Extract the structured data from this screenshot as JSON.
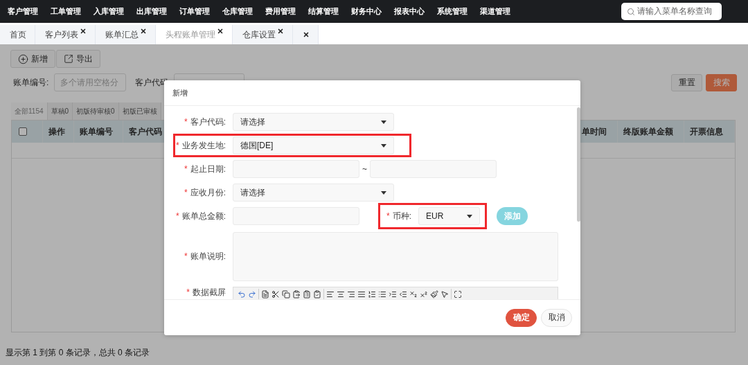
{
  "top_nav": {
    "items": [
      "客户管理",
      "工单管理",
      "入库管理",
      "出库管理",
      "订单管理",
      "仓库管理",
      "费用管理",
      "结算管理",
      "财务中心",
      "报表中心",
      "系统管理",
      "渠道管理"
    ],
    "search": {
      "placeholder": "请输入菜单名称查询"
    }
  },
  "tabs": {
    "items": [
      {
        "label": "首页",
        "selected": false,
        "closable": false
      },
      {
        "label": "客户列表",
        "selected": false,
        "closable": true
      },
      {
        "label": "账单汇总",
        "selected": false,
        "closable": true
      },
      {
        "label": "头程账单管理",
        "selected": true,
        "closable": true
      },
      {
        "label": "仓库设置",
        "selected": false,
        "closable": true
      }
    ],
    "close_all": true
  },
  "toolbar": {
    "buttons": [
      {
        "label": "新增",
        "kind": "add"
      },
      {
        "label": "导出",
        "kind": "export"
      }
    ]
  },
  "filters": [
    {
      "label": "账单编号:",
      "placeholder": "多个请用空格分"
    },
    {
      "label": "客户代码"
    }
  ],
  "filter_buttons": [
    {
      "label": "重置",
      "kind": "reset"
    },
    {
      "label": "搜索",
      "kind": "search"
    }
  ],
  "status_tabs": [
    {
      "label": "全部1154",
      "selected": true
    },
    {
      "label": "草稿0",
      "selected": false
    },
    {
      "label": "初版待审核0",
      "selected": false
    },
    {
      "label": "初版已审核",
      "selected": false
    }
  ],
  "table": {
    "select_all_checked": false,
    "columns": [
      "操作",
      "账单编号",
      "客户代码",
      "单时间",
      "终版账单金额",
      "开票信息"
    ]
  },
  "pagination_info": "显示第 1 到第 0 条记录，总共 0 条记录",
  "dialog": {
    "title": "新增",
    "fields": [
      {
        "kind": "select",
        "mark": "*",
        "label": "客户代码:",
        "placeholder": "请选择",
        "highlighted": false
      },
      {
        "kind": "select",
        "mark": "*",
        "label": "业务发生地:",
        "value": "德国[DE]",
        "highlighted": true
      },
      {
        "kind": "date_range",
        "mark": "*",
        "label": "起止日期:",
        "separator": "~",
        "highlighted": false
      },
      {
        "kind": "select",
        "mark": "*",
        "label": "应收月份:",
        "placeholder": "请选择",
        "highlighted": false
      },
      {
        "kind": "amount",
        "mark": "*",
        "label": "账单总金额:",
        "highlighted": false,
        "currency": {
          "mark": "*",
          "label": "币种:",
          "value": "EUR",
          "highlighted": true
        },
        "add_button": "添加"
      },
      {
        "kind": "textarea",
        "mark": "*",
        "label": "账单说明:",
        "highlighted": false
      },
      {
        "kind": "editor",
        "mark": "*",
        "label": "数据截屏",
        "highlighted": false
      }
    ],
    "buttons": [
      {
        "label": "确定",
        "kind": "primary"
      },
      {
        "label": "取消",
        "kind": "default"
      }
    ]
  }
}
